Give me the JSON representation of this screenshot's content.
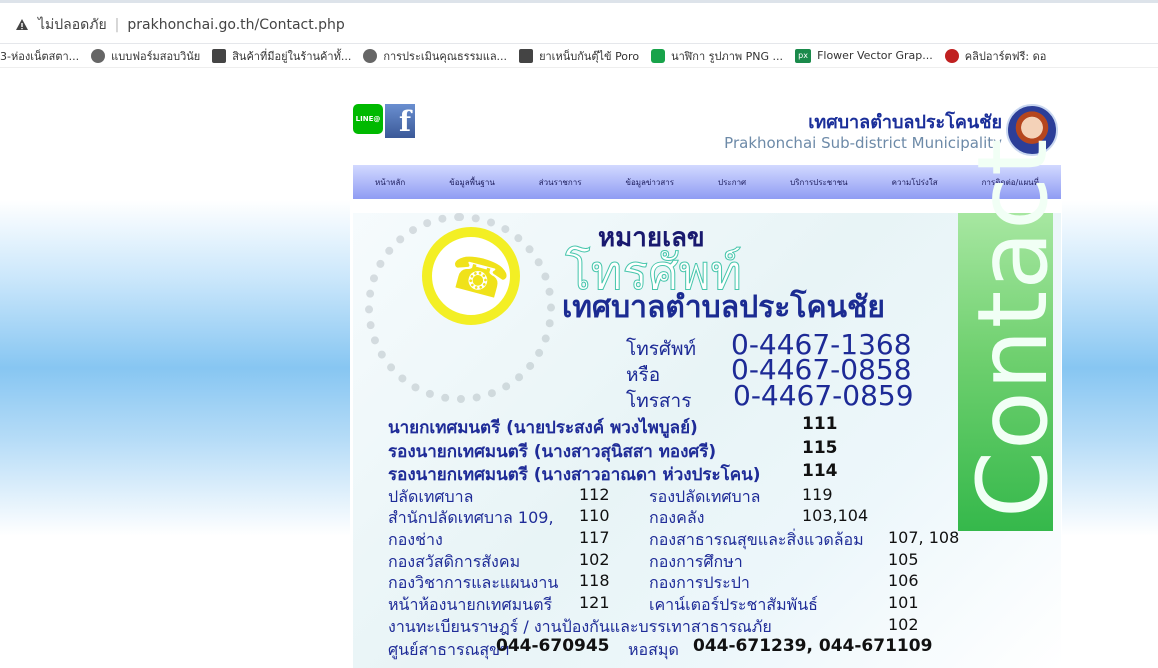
{
  "browser": {
    "security_label": "ไม่ปลอดภัย",
    "url": "prakhonchai.go.th/Contact.php",
    "bookmarks": [
      "3-ห่องเน็ตสตา...",
      "แบบฟอร์มสอบวินัย",
      "สินค้าที่มีอยู่ในร้านค้าทั้...",
      "การประเมินคุณธรรมแล...",
      "ยาเหน็บกันตุ๊ไข้ Poro",
      "นาฬิกา รูปภาพ PNG ...",
      "Flower Vector Grap...",
      "คลิปอาร์ตฟรี: ดอ"
    ]
  },
  "site": {
    "social_line": "LINE@",
    "social_fb": "f",
    "brand_th": "เทศบาลตำบลประโคนชัย",
    "brand_en": "Prakhonchai Sub-district Municipality",
    "nav": [
      "หน้าหลัก",
      "ข้อมูลพื้นฐาน",
      "ส่วนราชการ",
      "ข้อมูลข่าวสาร",
      "ประกาศ",
      "บริการประชาชน",
      "ความโปร่งใส",
      "การติดต่อ/แผนที่"
    ]
  },
  "banner": {
    "heading_small": "หมายเลข",
    "heading_large": "โทรศัพท์",
    "heading_org": "เทศบาลตำบลประโคนชัย",
    "contact_word": "Contact",
    "phone_label": "โทรศัพท์",
    "phone_1": "0-4467-1368",
    "or_label": "หรือ",
    "phone_2": "0-4467-0858",
    "fax_label": "โทรสาร",
    "phone_3": "0-4467-0859",
    "rows": [
      {
        "label": "นายกเทศมนตรี (นายประสงค์ พวงไพบูลย์)",
        "value": "111"
      },
      {
        "label": "รองนายกเทศมนตรี (นางสาวสุนิสสา ทองศรี)",
        "value": "115"
      },
      {
        "label": "รองนายกเทศมนตรี (นางสาวอาณดา ห่วงประโคน)",
        "value": "114"
      }
    ],
    "grid": [
      {
        "left": "ปลัดเทศบาล",
        "left_num": "112",
        "right": "รองปลัดเทศบาล",
        "right_num": "119"
      },
      {
        "left": "สำนักปลัดเทศบาล 109,",
        "left_num": "110",
        "right": "กองคลัง",
        "right_num": "103,104"
      },
      {
        "left": "กองช่าง",
        "left_num": "117",
        "right": "กองสาธารณสุขและสิ่งแวดล้อม",
        "right_num": "107, 108"
      },
      {
        "left": "กองสวัสดิการสังคม",
        "left_num": "102",
        "right": "กองการศึกษา",
        "right_num": "105"
      },
      {
        "left": "กองวิชาการและแผนงาน",
        "left_num": "118",
        "right": "กองการประปา",
        "right_num": "106"
      },
      {
        "left": "หน้าห้องนายกเทศมนตรี",
        "left_num": "121",
        "right": "เคาน์เตอร์ประชาสัมพันธ์",
        "right_num": "101"
      }
    ],
    "reg_label": "งานทะเบียนราษฎร์ / งานป้องกันและบรรเทาสาธารณภัย",
    "reg_num": "102",
    "health_label": "ศูนย์สาธารณสุขฯ",
    "health_num": "044-670945",
    "library_label": "หอสมุด",
    "library_nums": "044-671239, 044-671109"
  }
}
